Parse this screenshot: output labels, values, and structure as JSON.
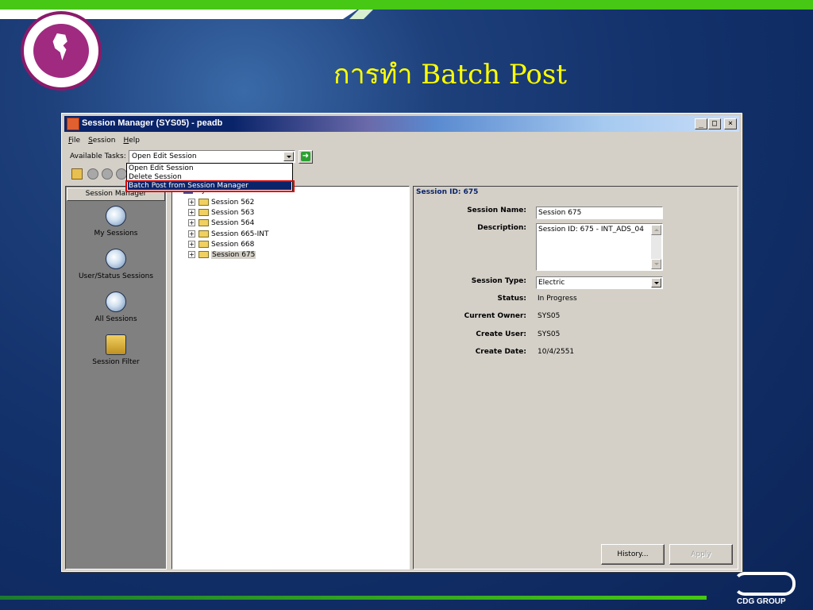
{
  "slide": {
    "title": "การทำ Batch Post",
    "logo_icon": "organization-seal-logo",
    "brand_text": "CDG GROUP",
    "colors": {
      "title": "#ffff00",
      "band": "#46c814",
      "background": "#12306a"
    }
  },
  "window": {
    "title": "Session Manager (SYS05) - peadb",
    "controls": [
      "_",
      "□",
      "×"
    ]
  },
  "menu": {
    "items": [
      {
        "underline": "F",
        "rest": "ile"
      },
      {
        "underline": "S",
        "rest": "ession"
      },
      {
        "underline": "H",
        "rest": "elp"
      }
    ]
  },
  "tasks": {
    "label": "Available Tasks:",
    "selected": "Open Edit Session",
    "options": [
      "Open Edit Session",
      "Delete Session",
      "Batch Post from Session Manager"
    ],
    "highlighted": "Batch Post from Session Manager"
  },
  "left_panel": {
    "header": "Session Manager",
    "items": [
      {
        "label": "My Sessions",
        "icon": "globe-user-icon"
      },
      {
        "label": "User/Status Sessions",
        "icon": "globe-question-icon"
      },
      {
        "label": "All Sessions",
        "icon": "globe-users-icon"
      },
      {
        "label": "Session Filter",
        "icon": "binoculars-icon"
      }
    ]
  },
  "tree": {
    "root": "My Sessions",
    "items": [
      {
        "label": "Session 562"
      },
      {
        "label": "Session 563"
      },
      {
        "label": "Session 564"
      },
      {
        "label": "Session 665-INT"
      },
      {
        "label": "Session 668"
      },
      {
        "label": "Session 675",
        "selected": true
      }
    ]
  },
  "details": {
    "session_id": "Session ID: 675",
    "fields": {
      "session_name_label": "Session Name:",
      "session_name": "Session 675",
      "description_label": "Description:",
      "description": "Session ID: 675 - INT_ADS_04",
      "session_type_label": "Session Type:",
      "session_type": "Electric",
      "status_label": "Status:",
      "status": "In Progress",
      "current_owner_label": "Current Owner:",
      "current_owner": "SYS05",
      "create_user_label": "Create User:",
      "create_user": "SYS05",
      "create_date_label": "Create Date:",
      "create_date": "10/4/2551"
    },
    "buttons": {
      "history": "History...",
      "apply": "Apply"
    }
  }
}
